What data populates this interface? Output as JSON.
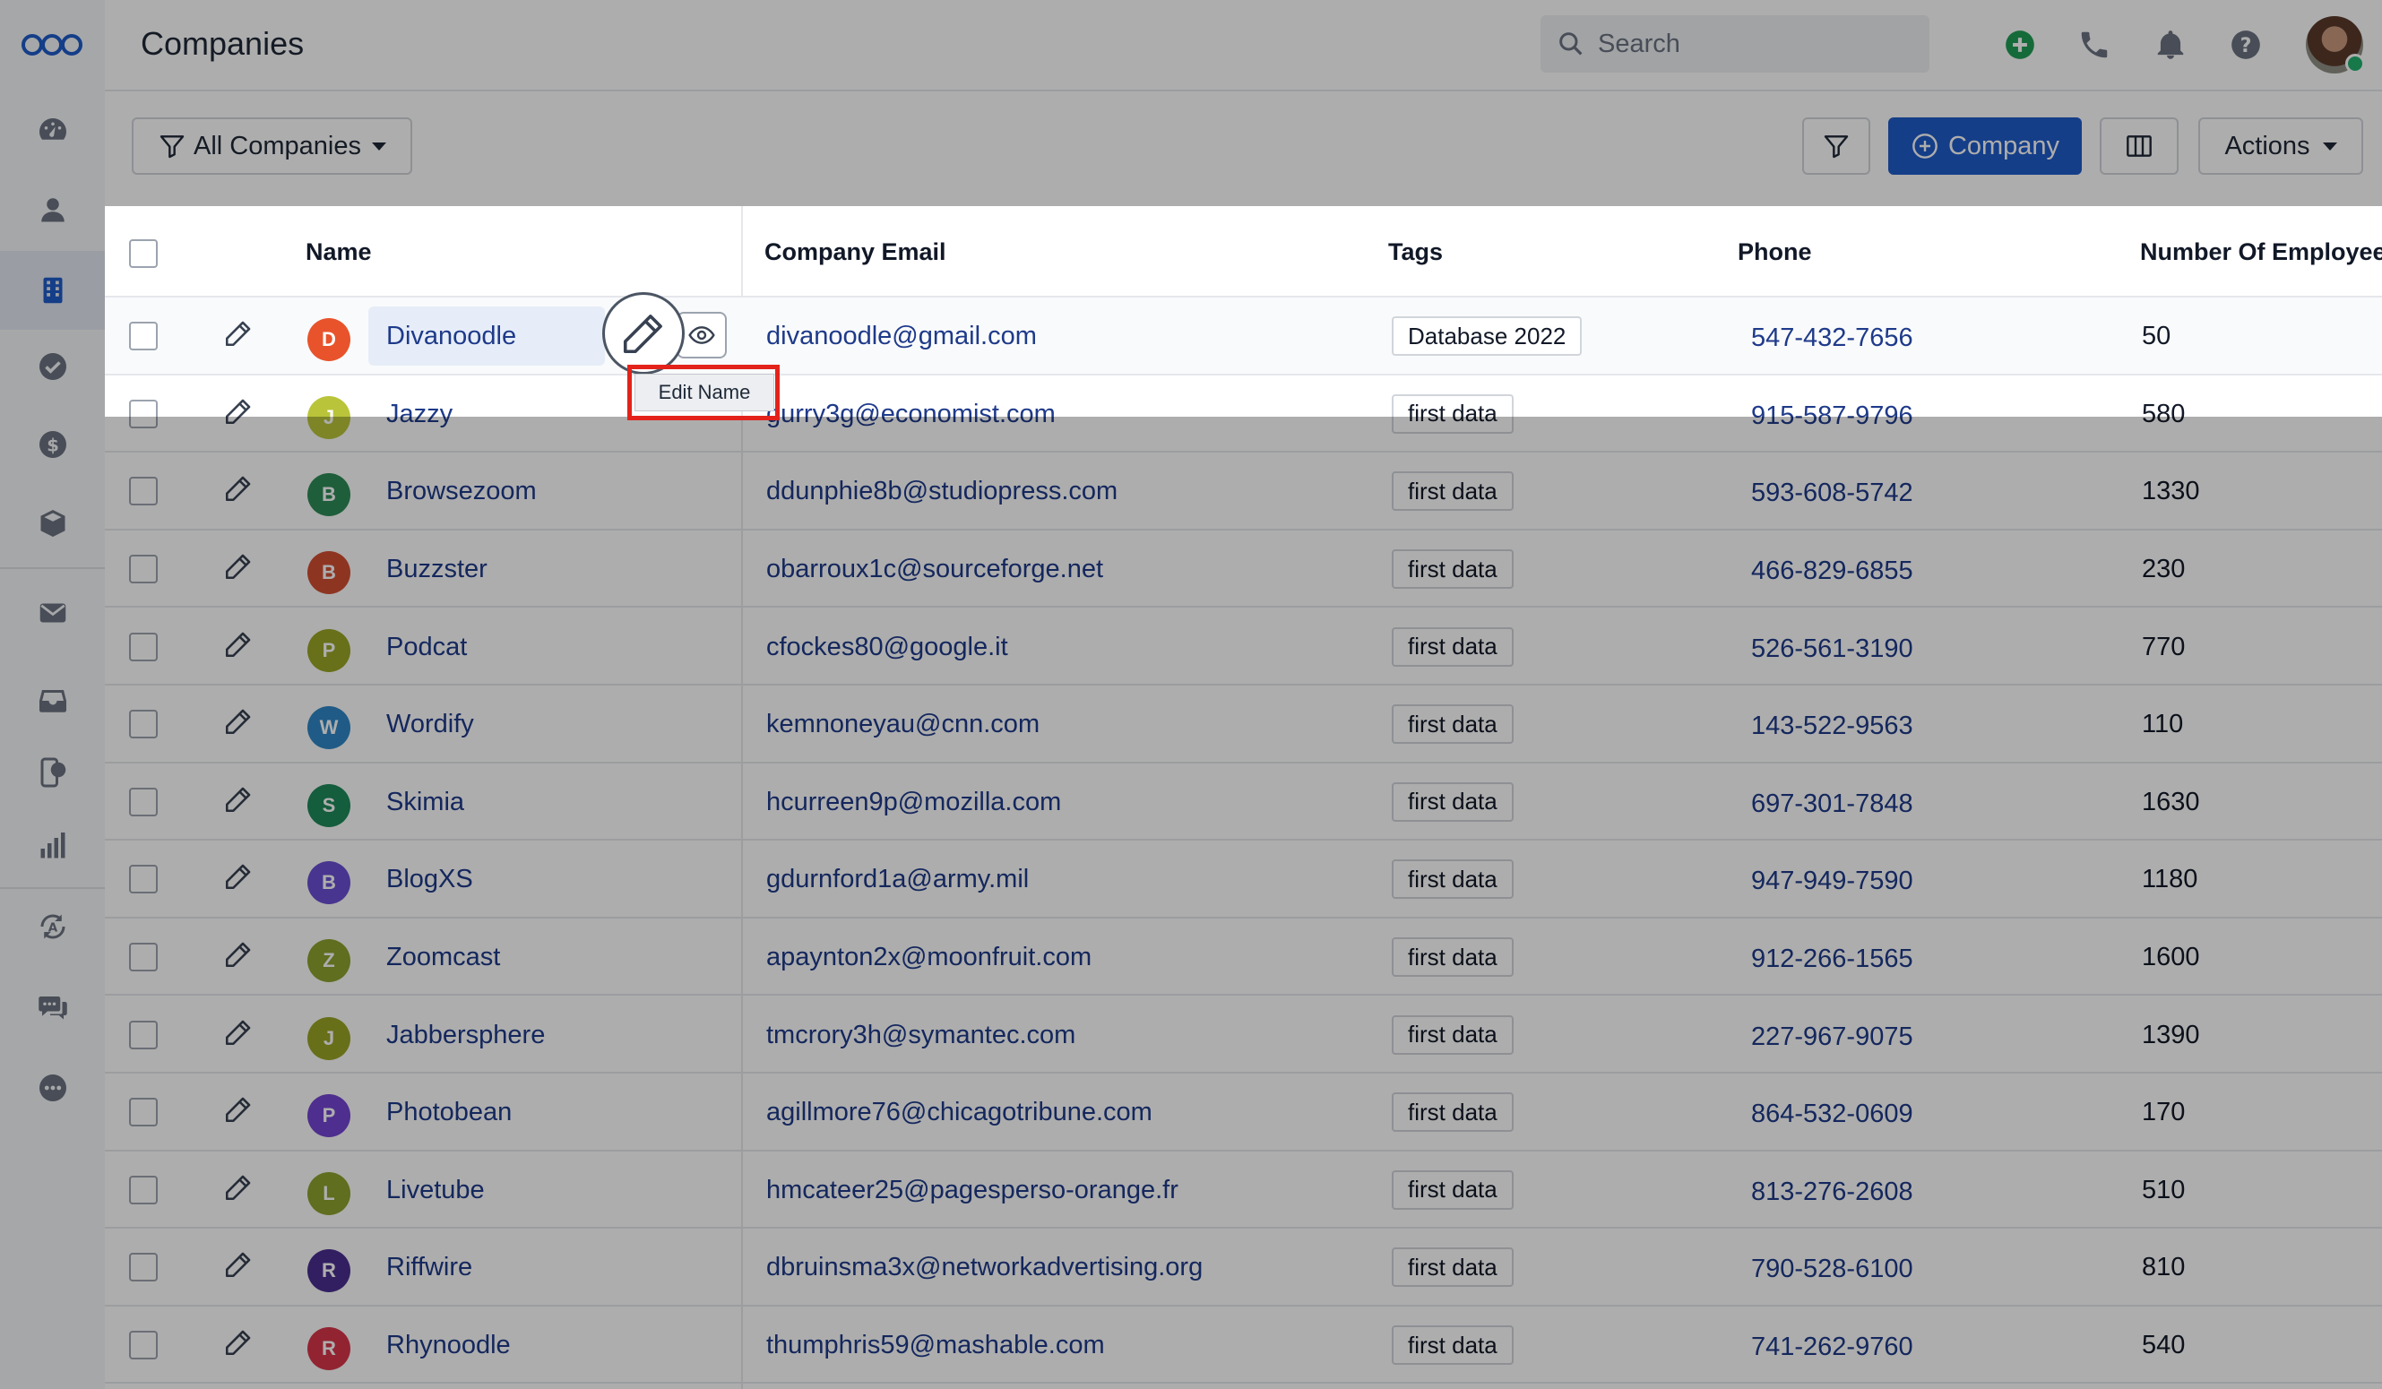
{
  "header": {
    "title": "Companies"
  },
  "search": {
    "placeholder": "Search"
  },
  "toolbar": {
    "view_label": "All Companies",
    "add_label": "Company",
    "actions_label": "Actions"
  },
  "table": {
    "columns": [
      "Name",
      "Company Email",
      "Tags",
      "Phone",
      "Number Of Employee"
    ],
    "rows": [
      {
        "initial": "D",
        "color": "#e8532b",
        "name": "Divanoodle",
        "email": "divanoodle@gmail.com",
        "tag": "Database 2022",
        "phone": "547-432-7656",
        "employees": "50"
      },
      {
        "initial": "J",
        "color": "#b9c43a",
        "name": "Jazzy",
        "email": "gurry3g@economist.com",
        "tag": "first data",
        "phone": "915-587-9796",
        "employees": "580"
      },
      {
        "initial": "B",
        "color": "#2e8b57",
        "name": "Browsezoom",
        "email": "ddunphie8b@studiopress.com",
        "tag": "first data",
        "phone": "593-608-5742",
        "employees": "1330"
      },
      {
        "initial": "B",
        "color": "#d14f33",
        "name": "Buzzster",
        "email": "obarroux1c@sourceforge.net",
        "tag": "first data",
        "phone": "466-829-6855",
        "employees": "230"
      },
      {
        "initial": "P",
        "color": "#9aa626",
        "name": "Podcat",
        "email": "cfockes80@google.it",
        "tag": "first data",
        "phone": "526-561-3190",
        "employees": "770"
      },
      {
        "initial": "W",
        "color": "#2f86c6",
        "name": "Wordify",
        "email": "kemnoneyau@cnn.com",
        "tag": "first data",
        "phone": "143-522-9563",
        "employees": "110"
      },
      {
        "initial": "S",
        "color": "#1e8a5a",
        "name": "Skimia",
        "email": "hcurreen9p@mozilla.com",
        "tag": "first data",
        "phone": "697-301-7848",
        "employees": "1630"
      },
      {
        "initial": "B",
        "color": "#6a4fd3",
        "name": "BlogXS",
        "email": "gdurnford1a@army.mil",
        "tag": "first data",
        "phone": "947-949-7590",
        "employees": "1180"
      },
      {
        "initial": "Z",
        "color": "#8da32e",
        "name": "Zoomcast",
        "email": "apaynton2x@moonfruit.com",
        "tag": "first data",
        "phone": "912-266-1565",
        "employees": "1600"
      },
      {
        "initial": "J",
        "color": "#9aa426",
        "name": "Jabbersphere",
        "email": "tmcrory3h@symantec.com",
        "tag": "first data",
        "phone": "227-967-9075",
        "employees": "1390"
      },
      {
        "initial": "P",
        "color": "#7444d2",
        "name": "Photobean",
        "email": "agillmore76@chicagotribune.com",
        "tag": "first data",
        "phone": "864-532-0609",
        "employees": "170"
      },
      {
        "initial": "L",
        "color": "#8da32e",
        "name": "Livetube",
        "email": "hmcateer25@pagesperso-orange.fr",
        "tag": "first data",
        "phone": "813-276-2608",
        "employees": "510"
      },
      {
        "initial": "R",
        "color": "#4b2f8f",
        "name": "Riffwire",
        "email": "dbruinsma3x@networkadvertising.org",
        "tag": "first data",
        "phone": "790-528-6100",
        "employees": "810"
      },
      {
        "initial": "R",
        "color": "#d8364a",
        "name": "Rhynoodle",
        "email": "thumphris59@mashable.com",
        "tag": "first data",
        "phone": "741-262-9760",
        "employees": "540"
      }
    ]
  },
  "tooltip": {
    "text": "Edit Name"
  },
  "colors": {
    "primary": "#1f5cc9",
    "link": "#1e3a8a",
    "highlight_frame": "#e3231b",
    "online": "#23b26d"
  }
}
